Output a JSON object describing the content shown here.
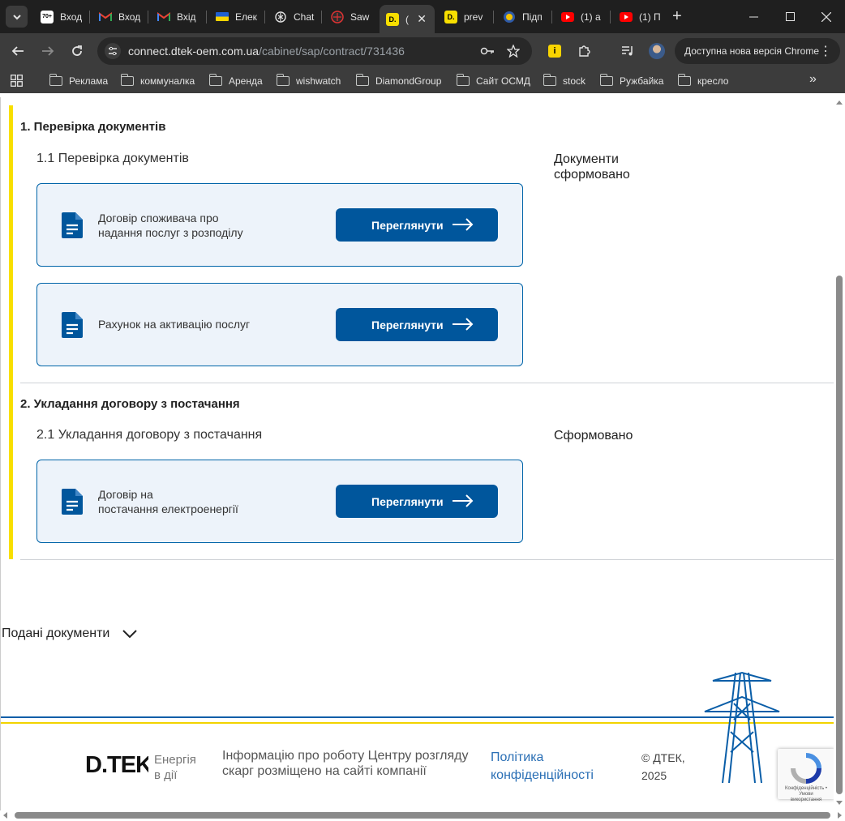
{
  "browser": {
    "tabs": [
      {
        "label": "Вход",
        "icon": "ukrnet-icon",
        "badge": "70+"
      },
      {
        "label": "Вход",
        "icon": "gmail-icon"
      },
      {
        "label": "Вхід",
        "icon": "gmail-icon"
      },
      {
        "label": "Елек",
        "icon": "ukraine-flag-icon"
      },
      {
        "label": "Chat",
        "icon": "chatgpt-icon"
      },
      {
        "label": "Saw",
        "icon": "saw-icon"
      },
      {
        "label": "(",
        "icon": "dtek-icon",
        "active": true
      },
      {
        "label": "prev",
        "icon": "dtek-icon"
      },
      {
        "label": "Підп",
        "icon": "gov-seal-icon"
      },
      {
        "label": "(1) а",
        "icon": "youtube-icon"
      },
      {
        "label": "(1) П",
        "icon": "youtube-icon"
      }
    ],
    "url_host": "connect.dtek-oem.com.ua",
    "url_path": "/cabinet/sap/contract/731436",
    "update_label": "Доступна нова версія Chrome",
    "bookmarks": [
      "Реклама",
      "коммуналка",
      "Аренда",
      "wishwatch",
      "DiamondGroup",
      "Сайт ОСМД",
      "stock",
      "Ружбайка",
      "кресло"
    ]
  },
  "sections": [
    {
      "title": "1. Перевірка документів",
      "subtitle": "1.1 Перевірка документів",
      "status": "Документи сформовано",
      "documents": [
        {
          "line1": "Договір споживача про",
          "line2": "надання послуг з розподілу",
          "button": "Переглянути"
        },
        {
          "line1": "Рахунок на активацію послуг",
          "line2": "",
          "button": "Переглянути"
        }
      ]
    },
    {
      "title": "2. Укладання договору з постачання",
      "subtitle": "2.1 Укладання договору з постачання",
      "status": "Сформовано",
      "documents": [
        {
          "line1": "Договір на",
          "line2": "постачання електроенергії",
          "button": "Переглянути"
        }
      ]
    }
  ],
  "submitted_docs_label": "Подані документи",
  "footer": {
    "logo_text": "D.TEK",
    "tagline_1": "Енергія",
    "tagline_2": "в дії",
    "info_1": "Інформацію про роботу Центру розгляду",
    "info_2": "скарг розміщено на сайті компанії",
    "policy_1": "Політика",
    "policy_2": "конфіденційності",
    "copyright_1": "© ДТЕК,",
    "copyright_2": "2025",
    "recaptcha_1": "Конфіденційність • Умови",
    "recaptcha_2": "використання"
  },
  "colors": {
    "accent": "#00569c",
    "brand_yellow": "#f8df00",
    "card_bg": "#edf3fa",
    "link": "#2a6fb5"
  }
}
